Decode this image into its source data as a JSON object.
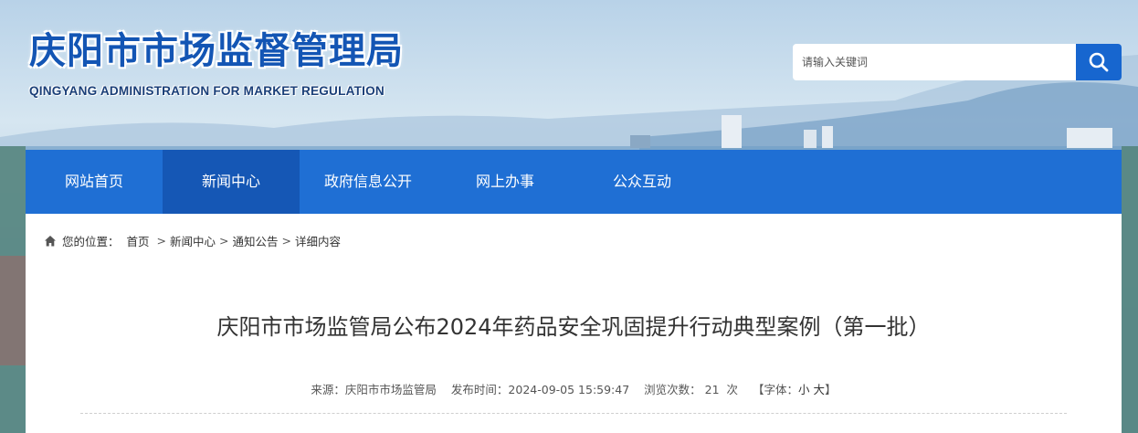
{
  "site": {
    "name_cn": "庆阳市市场监督管理局",
    "name_en": "QINGYANG ADMINISTRATION FOR MARKET REGULATION"
  },
  "search": {
    "placeholder": "请输入关键词",
    "icon": "search-icon"
  },
  "nav": {
    "items": [
      {
        "label": "网站首页",
        "active": false
      },
      {
        "label": "新闻中心",
        "active": true
      },
      {
        "label": "政府信息公开",
        "active": false
      },
      {
        "label": "网上办事",
        "active": false
      },
      {
        "label": "公众互动",
        "active": false
      }
    ]
  },
  "breadcrumb": {
    "prefix": "您的位置：",
    "items": [
      "首页",
      "新闻中心",
      "通知公告",
      "详细内容"
    ]
  },
  "article": {
    "title": "庆阳市市场监管局公布2024年药品安全巩固提升行动典型案例（第一批）",
    "source": "来源：庆阳市市场监管局",
    "published": "发布时间：2024-09-05 15:59:47",
    "views_label": "浏览次数：",
    "views": "21",
    "views_unit": "次",
    "font_label": "【字体：",
    "font_small": "小",
    "font_large": "大",
    "font_close": "】"
  },
  "colors": {
    "brand_blue": "#1f6fd4",
    "nav_active": "#1557b5",
    "logo_text": "#1355b4"
  }
}
